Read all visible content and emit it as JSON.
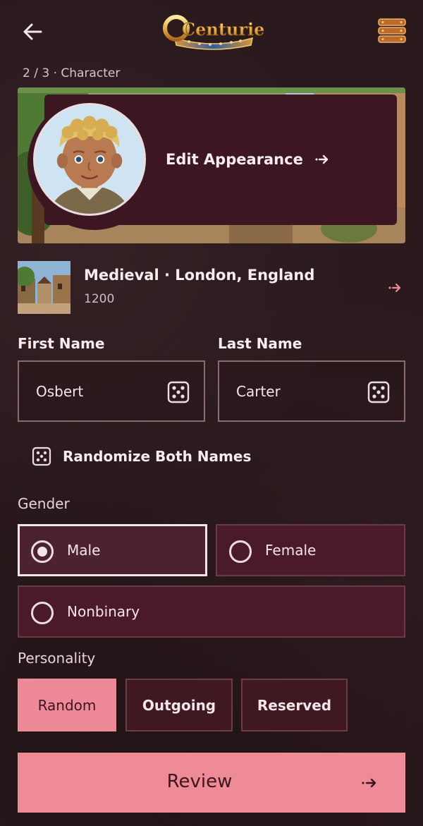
{
  "header": {
    "back_icon": "arrow-left-icon",
    "logo_text": "Centuries",
    "menu_icon": "stacked-menu-icon",
    "step": "2 / 3 · Character"
  },
  "banner": {
    "edit_label": "Edit Appearance",
    "arrow_icon": "sparkle-arrow-icon"
  },
  "era": {
    "title": "Medieval · London, England",
    "year": "1200",
    "arrow_icon": "sparkle-arrow-icon"
  },
  "names": {
    "first_label": "First Name",
    "first_value": "Osbert",
    "last_label": "Last Name",
    "last_value": "Carter",
    "dice_icon": "dice-icon",
    "randomize_both": "Randomize Both Names"
  },
  "gender": {
    "label": "Gender",
    "options": [
      {
        "label": "Male",
        "selected": true
      },
      {
        "label": "Female",
        "selected": false
      },
      {
        "label": "Nonbinary",
        "selected": false
      }
    ]
  },
  "personality": {
    "label": "Personality",
    "options": [
      {
        "label": "Random",
        "active": true
      },
      {
        "label": "Outgoing",
        "active": false
      },
      {
        "label": "Reserved",
        "active": false
      }
    ]
  },
  "review": {
    "label": "Review"
  },
  "colors": {
    "background": "#2a1a1d",
    "card": "#3c1621",
    "accent_pink": "#ef8a97",
    "option_bg": "#4a1a29"
  }
}
